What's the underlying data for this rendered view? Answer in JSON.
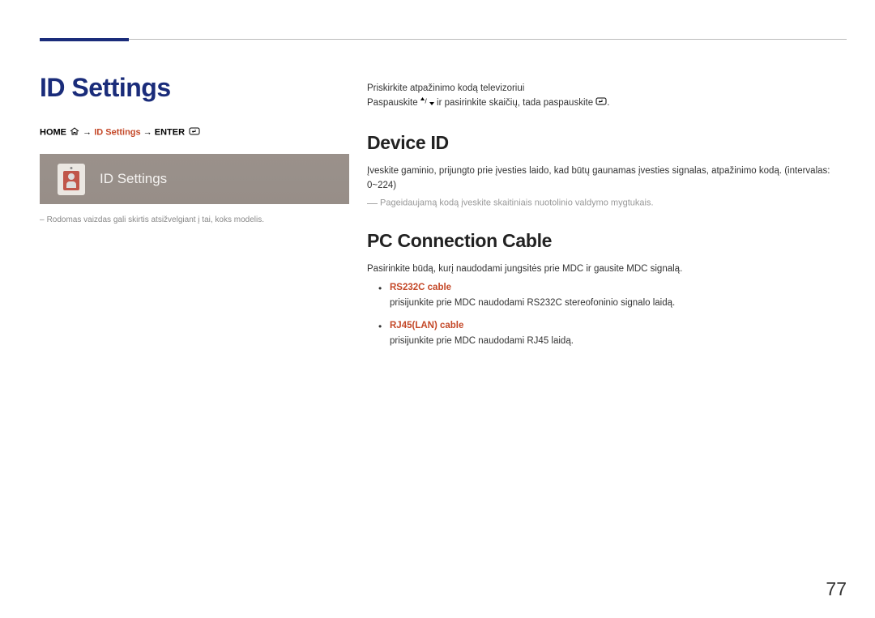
{
  "main_title": "ID Settings",
  "nav_path": {
    "home": "HOME",
    "arrow1": "→",
    "current": "ID Settings",
    "arrow2": "→",
    "enter": "ENTER"
  },
  "screenshot_label": "ID Settings",
  "image_note": "Rodomas vaizdas gali skirtis atsižvelgiant į tai, koks modelis.",
  "right": {
    "intro_line1": "Priskirkite atpažinimo kodą televizoriui",
    "intro_line2_a": "Paspauskite ",
    "intro_line2_b": " ir pasirinkite skaičių, tada paspauskite ",
    "intro_line2_c": ".",
    "sections": {
      "device_id": {
        "title": "Device ID",
        "body": "Įveskite gaminio, prijungto prie įvesties laido, kad būtų gaunamas įvesties signalas, atpažinimo kodą. (intervalas: 0~224)",
        "hint": "Pageidaujamą kodą įveskite skaitiniais nuotolinio valdymo mygtukais."
      },
      "pc_cable": {
        "title": "PC Connection Cable",
        "body": "Pasirinkite būdą, kurį naudodami jungsitės prie MDC ir gausite MDC signalą.",
        "items": [
          {
            "name": "RS232C cable",
            "desc": "prisijunkite prie MDC naudodami RS232C stereofoninio signalo laidą."
          },
          {
            "name": "RJ45(LAN) cable",
            "desc": "prisijunkite prie MDC naudodami RJ45 laidą."
          }
        ]
      }
    }
  },
  "page_number": "77"
}
